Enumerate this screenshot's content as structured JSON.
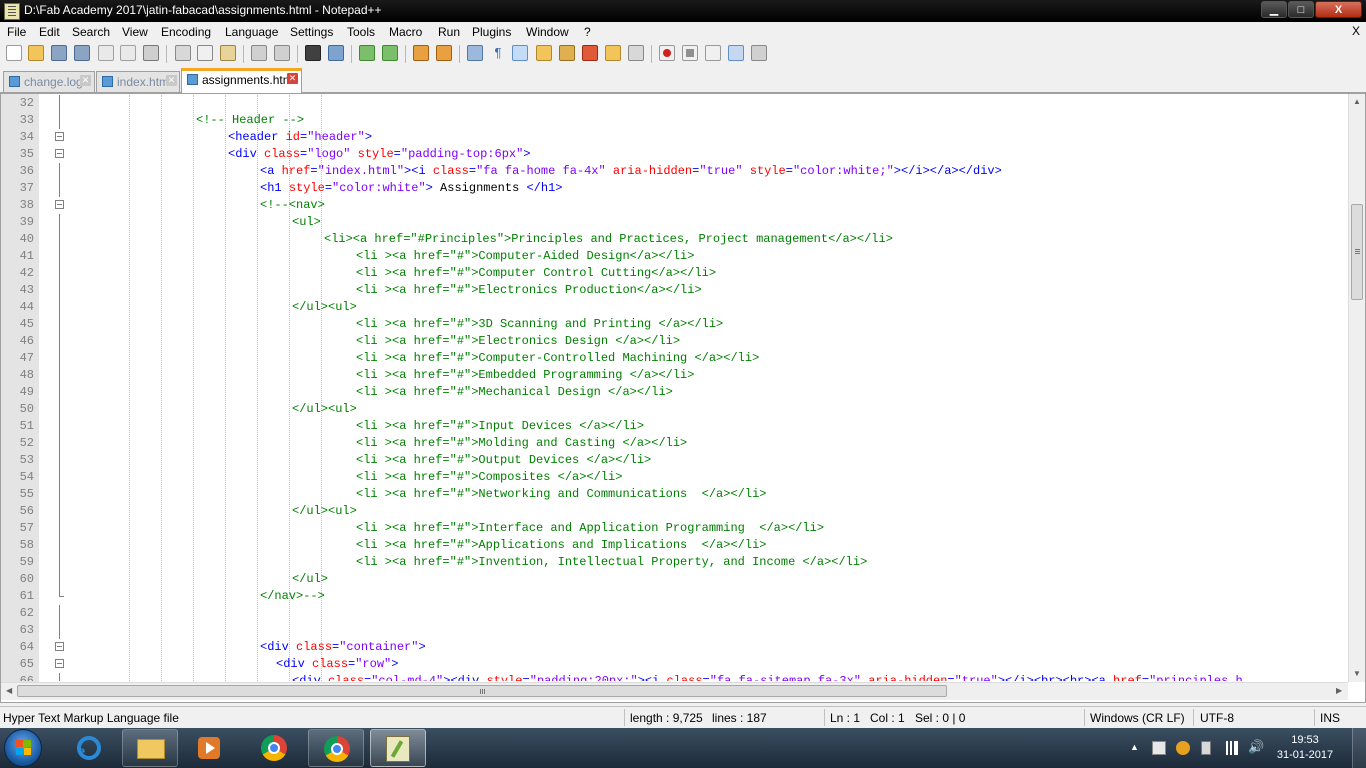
{
  "window": {
    "title": "D:\\Fab Academy 2017\\jatin-fabacad\\assignments.html - Notepad++",
    "minimize_label": "▁",
    "maximize_label": "□",
    "close_label": "X"
  },
  "menu": {
    "items": [
      "File",
      "Edit",
      "Search",
      "View",
      "Encoding",
      "Language",
      "Settings",
      "Tools",
      "Macro",
      "Run",
      "Plugins",
      "Window",
      "?"
    ],
    "close_doc": "X"
  },
  "tabs": [
    {
      "label": "change.log",
      "active": false
    },
    {
      "label": "index.html",
      "active": false
    },
    {
      "label": "assignments.html",
      "active": true
    }
  ],
  "editor": {
    "lines": [
      {
        "n": "32",
        "indent": 0,
        "fold": "line",
        "tokens": []
      },
      {
        "n": "33",
        "indent": 16,
        "fold": "line",
        "tokens": [
          [
            "com",
            "<!-- Header -->"
          ]
        ]
      },
      {
        "n": "34",
        "indent": 20,
        "fold": "box",
        "tokens": [
          [
            "tag",
            "<header "
          ],
          [
            "attr",
            "id"
          ],
          [
            "tag",
            "="
          ],
          [
            "val",
            "\"header\""
          ],
          [
            "tag",
            ">"
          ]
        ]
      },
      {
        "n": "35",
        "indent": 20,
        "fold": "box",
        "tokens": [
          [
            "tag",
            "<div "
          ],
          [
            "attr",
            "class"
          ],
          [
            "tag",
            "="
          ],
          [
            "val",
            "\"logo\""
          ],
          [
            "tag",
            " "
          ],
          [
            "attr",
            "style"
          ],
          [
            "tag",
            "="
          ],
          [
            "val",
            "\"padding-top:6px\""
          ],
          [
            "tag",
            ">"
          ]
        ]
      },
      {
        "n": "36",
        "indent": 24,
        "fold": "line",
        "tokens": [
          [
            "tag",
            "<a "
          ],
          [
            "attr",
            "href"
          ],
          [
            "tag",
            "="
          ],
          [
            "val",
            "\"index.html\""
          ],
          [
            "tag",
            "><i "
          ],
          [
            "attr",
            "class"
          ],
          [
            "tag",
            "="
          ],
          [
            "val",
            "\"fa fa-home fa-4x\""
          ],
          [
            "tag",
            " "
          ],
          [
            "attr",
            "aria-hidden"
          ],
          [
            "tag",
            "="
          ],
          [
            "val",
            "\"true\""
          ],
          [
            "tag",
            " "
          ],
          [
            "attr",
            "style"
          ],
          [
            "tag",
            "="
          ],
          [
            "val",
            "\"color:white;\""
          ],
          [
            "tag",
            "></i></a></div>"
          ]
        ]
      },
      {
        "n": "37",
        "indent": 24,
        "fold": "line",
        "tokens": [
          [
            "tag",
            "<h1 "
          ],
          [
            "attr",
            "style"
          ],
          [
            "tag",
            "="
          ],
          [
            "val",
            "\"color:white\""
          ],
          [
            "tag",
            ">"
          ],
          [
            "txt",
            " Assignments "
          ],
          [
            "tag",
            "</h1>"
          ]
        ]
      },
      {
        "n": "38",
        "indent": 24,
        "fold": "box",
        "tokens": [
          [
            "com",
            "<!--<nav>"
          ]
        ]
      },
      {
        "n": "39",
        "indent": 28,
        "fold": "line",
        "tokens": [
          [
            "com",
            "<ul>"
          ]
        ]
      },
      {
        "n": "40",
        "indent": 32,
        "fold": "line",
        "tokens": [
          [
            "com",
            "<li><a href=\"#Principles\">Principles and Practices, Project management</a></li>"
          ]
        ]
      },
      {
        "n": "41",
        "indent": 36,
        "fold": "line",
        "tokens": [
          [
            "com",
            "<li ><a href=\"#\">Computer-Aided Design</a></li>"
          ]
        ]
      },
      {
        "n": "42",
        "indent": 36,
        "fold": "line",
        "tokens": [
          [
            "com",
            "<li ><a href=\"#\">Computer Control Cutting</a></li>"
          ]
        ]
      },
      {
        "n": "43",
        "indent": 36,
        "fold": "line",
        "tokens": [
          [
            "com",
            "<li ><a href=\"#\">Electronics Production</a></li>"
          ]
        ]
      },
      {
        "n": "44",
        "indent": 28,
        "fold": "line",
        "tokens": [
          [
            "com",
            "</ul><ul>"
          ]
        ]
      },
      {
        "n": "45",
        "indent": 36,
        "fold": "line",
        "tokens": [
          [
            "com",
            "<li ><a href=\"#\">3D Scanning and Printing </a></li>"
          ]
        ]
      },
      {
        "n": "46",
        "indent": 36,
        "fold": "line",
        "tokens": [
          [
            "com",
            "<li ><a href=\"#\">Electronics Design </a></li>"
          ]
        ]
      },
      {
        "n": "47",
        "indent": 36,
        "fold": "line",
        "tokens": [
          [
            "com",
            "<li ><a href=\"#\">Computer-Controlled Machining </a></li>"
          ]
        ]
      },
      {
        "n": "48",
        "indent": 36,
        "fold": "line",
        "tokens": [
          [
            "com",
            "<li ><a href=\"#\">Embedded Programming </a></li>"
          ]
        ]
      },
      {
        "n": "49",
        "indent": 36,
        "fold": "line",
        "tokens": [
          [
            "com",
            "<li ><a href=\"#\">Mechanical Design </a></li>"
          ]
        ]
      },
      {
        "n": "50",
        "indent": 28,
        "fold": "line",
        "tokens": [
          [
            "com",
            "</ul><ul>"
          ]
        ]
      },
      {
        "n": "51",
        "indent": 36,
        "fold": "line",
        "tokens": [
          [
            "com",
            "<li ><a href=\"#\">Input Devices </a></li>"
          ]
        ]
      },
      {
        "n": "52",
        "indent": 36,
        "fold": "line",
        "tokens": [
          [
            "com",
            "<li ><a href=\"#\">Molding and Casting </a></li>"
          ]
        ]
      },
      {
        "n": "53",
        "indent": 36,
        "fold": "line",
        "tokens": [
          [
            "com",
            "<li ><a href=\"#\">Output Devices </a></li>"
          ]
        ]
      },
      {
        "n": "54",
        "indent": 36,
        "fold": "line",
        "tokens": [
          [
            "com",
            "<li ><a href=\"#\">Composites </a></li>"
          ]
        ]
      },
      {
        "n": "55",
        "indent": 36,
        "fold": "line",
        "tokens": [
          [
            "com",
            "<li ><a href=\"#\">Networking and Communications  </a></li>"
          ]
        ]
      },
      {
        "n": "56",
        "indent": 28,
        "fold": "line",
        "tokens": [
          [
            "com",
            "</ul><ul>"
          ]
        ]
      },
      {
        "n": "57",
        "indent": 36,
        "fold": "line",
        "tokens": [
          [
            "com",
            "<li ><a href=\"#\">Interface and Application Programming  </a></li>"
          ]
        ]
      },
      {
        "n": "58",
        "indent": 36,
        "fold": "line",
        "tokens": [
          [
            "com",
            "<li ><a href=\"#\">Applications and Implications  </a></li>"
          ]
        ]
      },
      {
        "n": "59",
        "indent": 36,
        "fold": "line",
        "tokens": [
          [
            "com",
            "<li ><a href=\"#\">Invention, Intellectual Property, and Income </a></li>"
          ]
        ]
      },
      {
        "n": "60",
        "indent": 28,
        "fold": "line",
        "tokens": [
          [
            "com",
            "</ul>"
          ]
        ]
      },
      {
        "n": "61",
        "indent": 24,
        "fold": "end",
        "tokens": [
          [
            "com",
            "</nav>-->"
          ]
        ]
      },
      {
        "n": "62",
        "indent": 0,
        "fold": "line",
        "tokens": []
      },
      {
        "n": "63",
        "indent": 0,
        "fold": "line",
        "tokens": []
      },
      {
        "n": "64",
        "indent": 24,
        "fold": "box",
        "tokens": [
          [
            "tag",
            "<div "
          ],
          [
            "attr",
            "class"
          ],
          [
            "tag",
            "="
          ],
          [
            "val",
            "\"container\""
          ],
          [
            "tag",
            ">"
          ]
        ]
      },
      {
        "n": "65",
        "indent": 26,
        "fold": "box",
        "tokens": [
          [
            "tag",
            "<div "
          ],
          [
            "attr",
            "class"
          ],
          [
            "tag",
            "="
          ],
          [
            "val",
            "\"row\""
          ],
          [
            "tag",
            ">"
          ]
        ]
      },
      {
        "n": "66",
        "indent": 28,
        "fold": "line",
        "tokens": [
          [
            "tag",
            "<div "
          ],
          [
            "attr",
            "class"
          ],
          [
            "tag",
            "="
          ],
          [
            "val",
            "\"col-md-4\""
          ],
          [
            "tag",
            "><div "
          ],
          [
            "attr",
            "style"
          ],
          [
            "tag",
            "="
          ],
          [
            "val",
            "\"padding:20px;\""
          ],
          [
            "tag",
            "><i "
          ],
          [
            "attr",
            "class"
          ],
          [
            "tag",
            "="
          ],
          [
            "val",
            "\"fa fa-sitemap fa-3x\""
          ],
          [
            "tag",
            " "
          ],
          [
            "attr",
            "aria-hidden"
          ],
          [
            "tag",
            "="
          ],
          [
            "val",
            "\"true\""
          ],
          [
            "tag",
            "></i><br><br><a "
          ],
          [
            "attr",
            "href"
          ],
          [
            "tag",
            "="
          ],
          [
            "val",
            "\"principles.h"
          ]
        ]
      }
    ]
  },
  "status": {
    "file_type": "Hyper Text Markup Language file",
    "length": "length : 9,725",
    "lines": "lines : 187",
    "ln": "Ln : 1",
    "col": "Col : 1",
    "sel": "Sel : 0 | 0",
    "eol": "Windows (CR LF)",
    "encoding": "UTF-8",
    "mode": "INS"
  },
  "taskbar": {
    "apps": [
      "file-explorer",
      "media-player",
      "chrome",
      "chrome",
      "notepad-plus-plus"
    ],
    "clock_time": "19:53",
    "clock_date": "31-01-2017"
  },
  "colors": {
    "tag": "#0000ff",
    "attribute": "#ff0000",
    "value": "#8000ff",
    "comment": "#008000",
    "active_tab_accent": "#f5a623"
  }
}
